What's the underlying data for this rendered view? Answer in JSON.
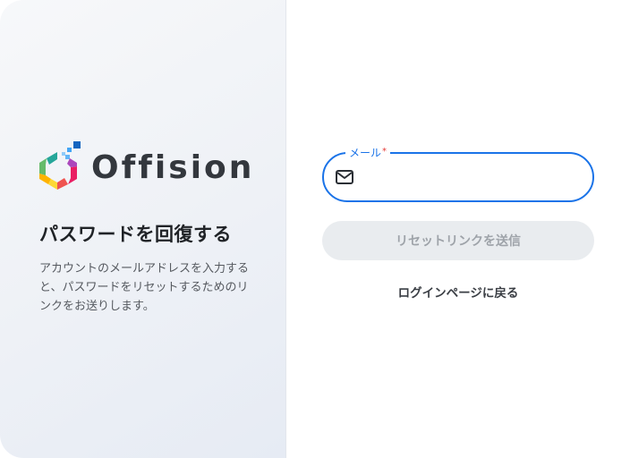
{
  "brand": {
    "name": "Offision",
    "logo_icon": "hexagon-logo-icon"
  },
  "left": {
    "heading": "パスワードを回復する",
    "description": "アカウントのメールアドレスを入力すると、パスワードをリセットするためのリンクをお送りします。"
  },
  "form": {
    "email": {
      "label": "メール",
      "required_mark": "*",
      "value": "",
      "placeholder": "",
      "icon": "mail-icon"
    },
    "submit_label": "リセットリンクを送信",
    "back_link": "ログインページに戻る"
  },
  "colors": {
    "accent": "#1a73e8",
    "required": "#e53935",
    "disabled_button_bg": "#e9ecef",
    "disabled_button_text": "#9ea3a9",
    "heading_text": "#202327"
  }
}
